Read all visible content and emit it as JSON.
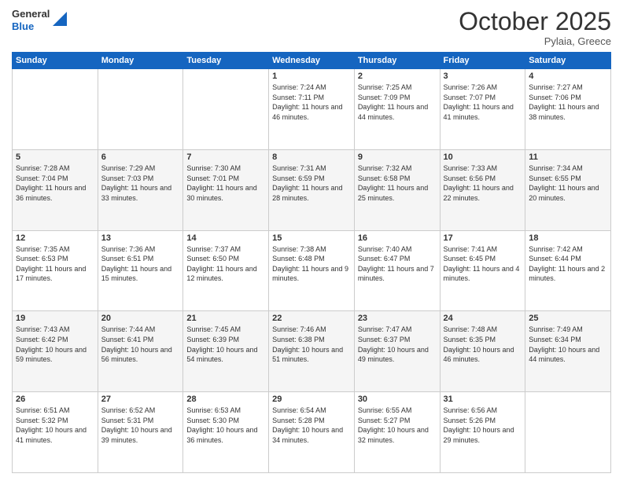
{
  "header": {
    "logo_line1": "General",
    "logo_line2": "Blue",
    "month": "October 2025",
    "location": "Pylaia, Greece"
  },
  "weekdays": [
    "Sunday",
    "Monday",
    "Tuesday",
    "Wednesday",
    "Thursday",
    "Friday",
    "Saturday"
  ],
  "weeks": [
    [
      {
        "day": "",
        "sunrise": "",
        "sunset": "",
        "daylight": ""
      },
      {
        "day": "",
        "sunrise": "",
        "sunset": "",
        "daylight": ""
      },
      {
        "day": "",
        "sunrise": "",
        "sunset": "",
        "daylight": ""
      },
      {
        "day": "1",
        "sunrise": "Sunrise: 7:24 AM",
        "sunset": "Sunset: 7:11 PM",
        "daylight": "Daylight: 11 hours and 46 minutes."
      },
      {
        "day": "2",
        "sunrise": "Sunrise: 7:25 AM",
        "sunset": "Sunset: 7:09 PM",
        "daylight": "Daylight: 11 hours and 44 minutes."
      },
      {
        "day": "3",
        "sunrise": "Sunrise: 7:26 AM",
        "sunset": "Sunset: 7:07 PM",
        "daylight": "Daylight: 11 hours and 41 minutes."
      },
      {
        "day": "4",
        "sunrise": "Sunrise: 7:27 AM",
        "sunset": "Sunset: 7:06 PM",
        "daylight": "Daylight: 11 hours and 38 minutes."
      }
    ],
    [
      {
        "day": "5",
        "sunrise": "Sunrise: 7:28 AM",
        "sunset": "Sunset: 7:04 PM",
        "daylight": "Daylight: 11 hours and 36 minutes."
      },
      {
        "day": "6",
        "sunrise": "Sunrise: 7:29 AM",
        "sunset": "Sunset: 7:03 PM",
        "daylight": "Daylight: 11 hours and 33 minutes."
      },
      {
        "day": "7",
        "sunrise": "Sunrise: 7:30 AM",
        "sunset": "Sunset: 7:01 PM",
        "daylight": "Daylight: 11 hours and 30 minutes."
      },
      {
        "day": "8",
        "sunrise": "Sunrise: 7:31 AM",
        "sunset": "Sunset: 6:59 PM",
        "daylight": "Daylight: 11 hours and 28 minutes."
      },
      {
        "day": "9",
        "sunrise": "Sunrise: 7:32 AM",
        "sunset": "Sunset: 6:58 PM",
        "daylight": "Daylight: 11 hours and 25 minutes."
      },
      {
        "day": "10",
        "sunrise": "Sunrise: 7:33 AM",
        "sunset": "Sunset: 6:56 PM",
        "daylight": "Daylight: 11 hours and 22 minutes."
      },
      {
        "day": "11",
        "sunrise": "Sunrise: 7:34 AM",
        "sunset": "Sunset: 6:55 PM",
        "daylight": "Daylight: 11 hours and 20 minutes."
      }
    ],
    [
      {
        "day": "12",
        "sunrise": "Sunrise: 7:35 AM",
        "sunset": "Sunset: 6:53 PM",
        "daylight": "Daylight: 11 hours and 17 minutes."
      },
      {
        "day": "13",
        "sunrise": "Sunrise: 7:36 AM",
        "sunset": "Sunset: 6:51 PM",
        "daylight": "Daylight: 11 hours and 15 minutes."
      },
      {
        "day": "14",
        "sunrise": "Sunrise: 7:37 AM",
        "sunset": "Sunset: 6:50 PM",
        "daylight": "Daylight: 11 hours and 12 minutes."
      },
      {
        "day": "15",
        "sunrise": "Sunrise: 7:38 AM",
        "sunset": "Sunset: 6:48 PM",
        "daylight": "Daylight: 11 hours and 9 minutes."
      },
      {
        "day": "16",
        "sunrise": "Sunrise: 7:40 AM",
        "sunset": "Sunset: 6:47 PM",
        "daylight": "Daylight: 11 hours and 7 minutes."
      },
      {
        "day": "17",
        "sunrise": "Sunrise: 7:41 AM",
        "sunset": "Sunset: 6:45 PM",
        "daylight": "Daylight: 11 hours and 4 minutes."
      },
      {
        "day": "18",
        "sunrise": "Sunrise: 7:42 AM",
        "sunset": "Sunset: 6:44 PM",
        "daylight": "Daylight: 11 hours and 2 minutes."
      }
    ],
    [
      {
        "day": "19",
        "sunrise": "Sunrise: 7:43 AM",
        "sunset": "Sunset: 6:42 PM",
        "daylight": "Daylight: 10 hours and 59 minutes."
      },
      {
        "day": "20",
        "sunrise": "Sunrise: 7:44 AM",
        "sunset": "Sunset: 6:41 PM",
        "daylight": "Daylight: 10 hours and 56 minutes."
      },
      {
        "day": "21",
        "sunrise": "Sunrise: 7:45 AM",
        "sunset": "Sunset: 6:39 PM",
        "daylight": "Daylight: 10 hours and 54 minutes."
      },
      {
        "day": "22",
        "sunrise": "Sunrise: 7:46 AM",
        "sunset": "Sunset: 6:38 PM",
        "daylight": "Daylight: 10 hours and 51 minutes."
      },
      {
        "day": "23",
        "sunrise": "Sunrise: 7:47 AM",
        "sunset": "Sunset: 6:37 PM",
        "daylight": "Daylight: 10 hours and 49 minutes."
      },
      {
        "day": "24",
        "sunrise": "Sunrise: 7:48 AM",
        "sunset": "Sunset: 6:35 PM",
        "daylight": "Daylight: 10 hours and 46 minutes."
      },
      {
        "day": "25",
        "sunrise": "Sunrise: 7:49 AM",
        "sunset": "Sunset: 6:34 PM",
        "daylight": "Daylight: 10 hours and 44 minutes."
      }
    ],
    [
      {
        "day": "26",
        "sunrise": "Sunrise: 6:51 AM",
        "sunset": "Sunset: 5:32 PM",
        "daylight": "Daylight: 10 hours and 41 minutes."
      },
      {
        "day": "27",
        "sunrise": "Sunrise: 6:52 AM",
        "sunset": "Sunset: 5:31 PM",
        "daylight": "Daylight: 10 hours and 39 minutes."
      },
      {
        "day": "28",
        "sunrise": "Sunrise: 6:53 AM",
        "sunset": "Sunset: 5:30 PM",
        "daylight": "Daylight: 10 hours and 36 minutes."
      },
      {
        "day": "29",
        "sunrise": "Sunrise: 6:54 AM",
        "sunset": "Sunset: 5:28 PM",
        "daylight": "Daylight: 10 hours and 34 minutes."
      },
      {
        "day": "30",
        "sunrise": "Sunrise: 6:55 AM",
        "sunset": "Sunset: 5:27 PM",
        "daylight": "Daylight: 10 hours and 32 minutes."
      },
      {
        "day": "31",
        "sunrise": "Sunrise: 6:56 AM",
        "sunset": "Sunset: 5:26 PM",
        "daylight": "Daylight: 10 hours and 29 minutes."
      },
      {
        "day": "",
        "sunrise": "",
        "sunset": "",
        "daylight": ""
      }
    ]
  ]
}
